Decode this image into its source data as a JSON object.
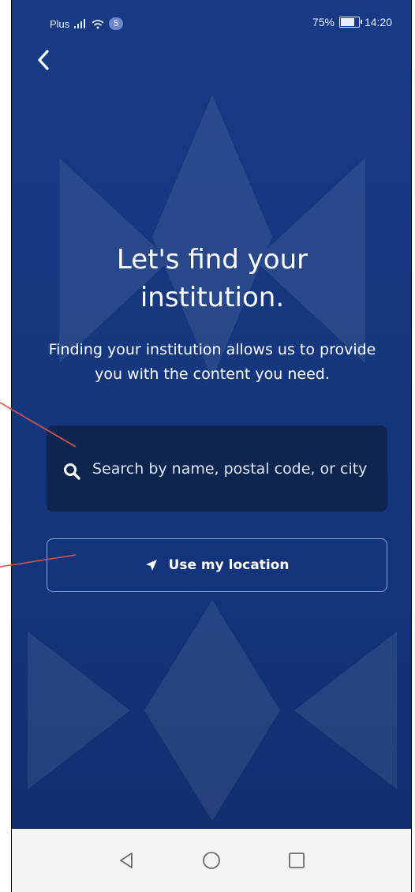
{
  "status_bar": {
    "carrier": "Plus",
    "notification_count": "5",
    "battery_percent": "75%",
    "time": "14:20"
  },
  "headline": {
    "line1": "Let's find your",
    "line2": "institution."
  },
  "subtext": "Finding your institution allows us to provide you with the content you need.",
  "search": {
    "placeholder": "Search by name, postal code, or city",
    "icon": "search-icon"
  },
  "location_button": {
    "label": "Use my location",
    "icon": "location-arrow-icon"
  },
  "nav_bar": {
    "icons": [
      "back-triangle-icon",
      "home-circle-icon",
      "recents-square-icon"
    ]
  },
  "colors": {
    "background_top": "#163a84",
    "background_bottom": "#12306f",
    "search_box": "#0e2550",
    "button_border": "#8ea3d6",
    "callout_line": "#d9534f"
  }
}
